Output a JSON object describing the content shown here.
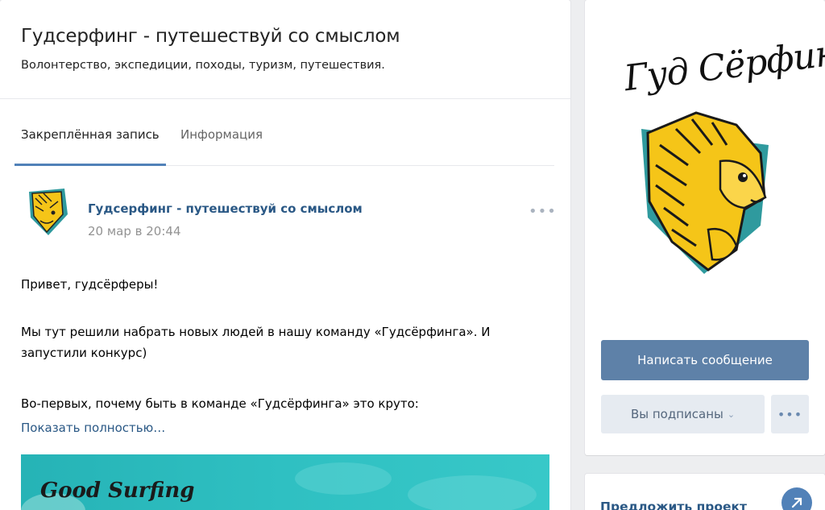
{
  "group": {
    "title": "Гудсерфинг - путешествуй со смыслом",
    "status": "Волонтерство, экспедиции, походы, туризм, путешествия."
  },
  "tabs": [
    {
      "label": "Закреплённая запись",
      "active": true
    },
    {
      "label": "Информация",
      "active": false
    }
  ],
  "post": {
    "author": "Гудсерфинг - путешествуй со смыслом",
    "date": "20 мар в 20:44",
    "more_icon": "more-dots-icon",
    "paragraphs": [
      "Привет, гудсёрферы!",
      "Мы тут решили набрать новых людей в нашу команду «Гудсёрфинга». И запустили конкурс)",
      "Во-первых, почему быть в команде «Гудсёрфинга» это круто:"
    ],
    "show_more": "Показать полностью…",
    "banner_text": "Good Surfing"
  },
  "sidebar": {
    "logo_text": "Гуд Сёрфинг",
    "write_message": "Написать сообщение",
    "subscribed": "Вы подписаны",
    "more_icon": "more-dots-icon",
    "propose": "Предложить проект"
  },
  "colors": {
    "accent": "#5181b8",
    "button_primary": "#5e81a8",
    "link": "#2a5885",
    "mascot_yellow": "#f5c518",
    "mascot_teal": "#2f9a9e",
    "banner_teal": "#2fc0c2"
  }
}
